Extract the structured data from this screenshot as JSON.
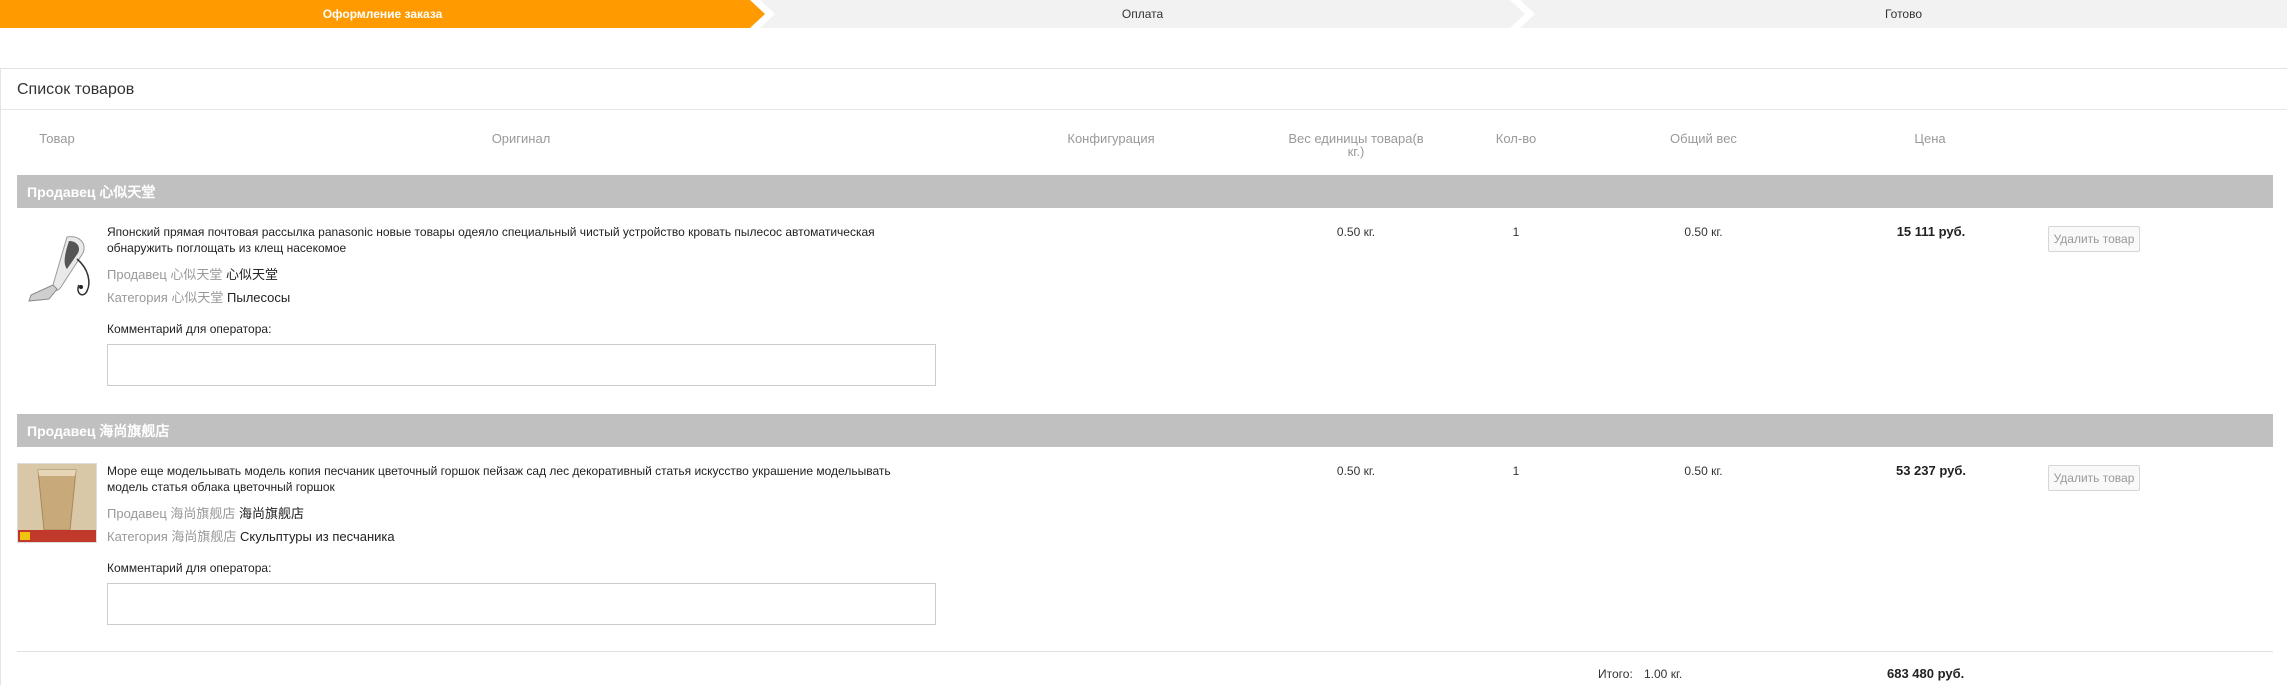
{
  "steps": [
    {
      "label": "Оформление заказа",
      "active": true
    },
    {
      "label": "Оплата",
      "active": false
    },
    {
      "label": "Готово",
      "active": false
    }
  ],
  "panel": {
    "title": "Список товаров",
    "columns": [
      "Товар",
      "Оригинал",
      "Конфигурация",
      "Вес единицы товара(в кг.)",
      "Кол-во",
      "Общий вес",
      "Цена"
    ]
  },
  "sellers": [
    {
      "bar": "Продавец 心似天堂",
      "item": {
        "title": "Японский прямая почтовая рассылка panasonic новые товары одеяло специальный чистый устройство кровать пылесос автоматическая обнаружить поглощать из клещ насекомое",
        "seller_label": "Продавец 心似天堂",
        "seller_value": "心似天堂",
        "category_label": "Категория 心似天堂",
        "category_value": "Пылесосы",
        "comment_label": "Комментарий для оператора:",
        "comment_value": "",
        "unit_weight": "0.50 кг.",
        "qty": "1",
        "total_weight": "0.50 кг.",
        "price": "15 111 руб.",
        "delete_label": "Удалить товар",
        "thumb_icon": "vacuum-cleaner-image"
      }
    },
    {
      "bar": "Продавец 海尚旗舰店",
      "item": {
        "title": "Море еще модельывать модель копия песчаник цветочный горшок пейзаж сад лес декоративный статья искусство украшение модельывать модель статья облака цветочный горшок",
        "seller_label": "Продавец 海尚旗舰店",
        "seller_value": "海尚旗舰店",
        "category_label": "Категория 海尚旗舰店",
        "category_value": "Скульптуры из песчаника",
        "comment_label": "Комментарий для оператора:",
        "comment_value": "",
        "unit_weight": "0.50 кг.",
        "qty": "1",
        "total_weight": "0.50 кг.",
        "price": "53 237 руб.",
        "delete_label": "Удалить товар",
        "thumb_icon": "flower-pot-image"
      }
    }
  ],
  "totals": {
    "label": "Итого:",
    "weight": "1.00 кг.",
    "price": "683 480 руб."
  },
  "colors": {
    "accent": "#ff9b00",
    "seller_bar": "#c0c0c0",
    "step_inactive": "#f2f2f2"
  }
}
